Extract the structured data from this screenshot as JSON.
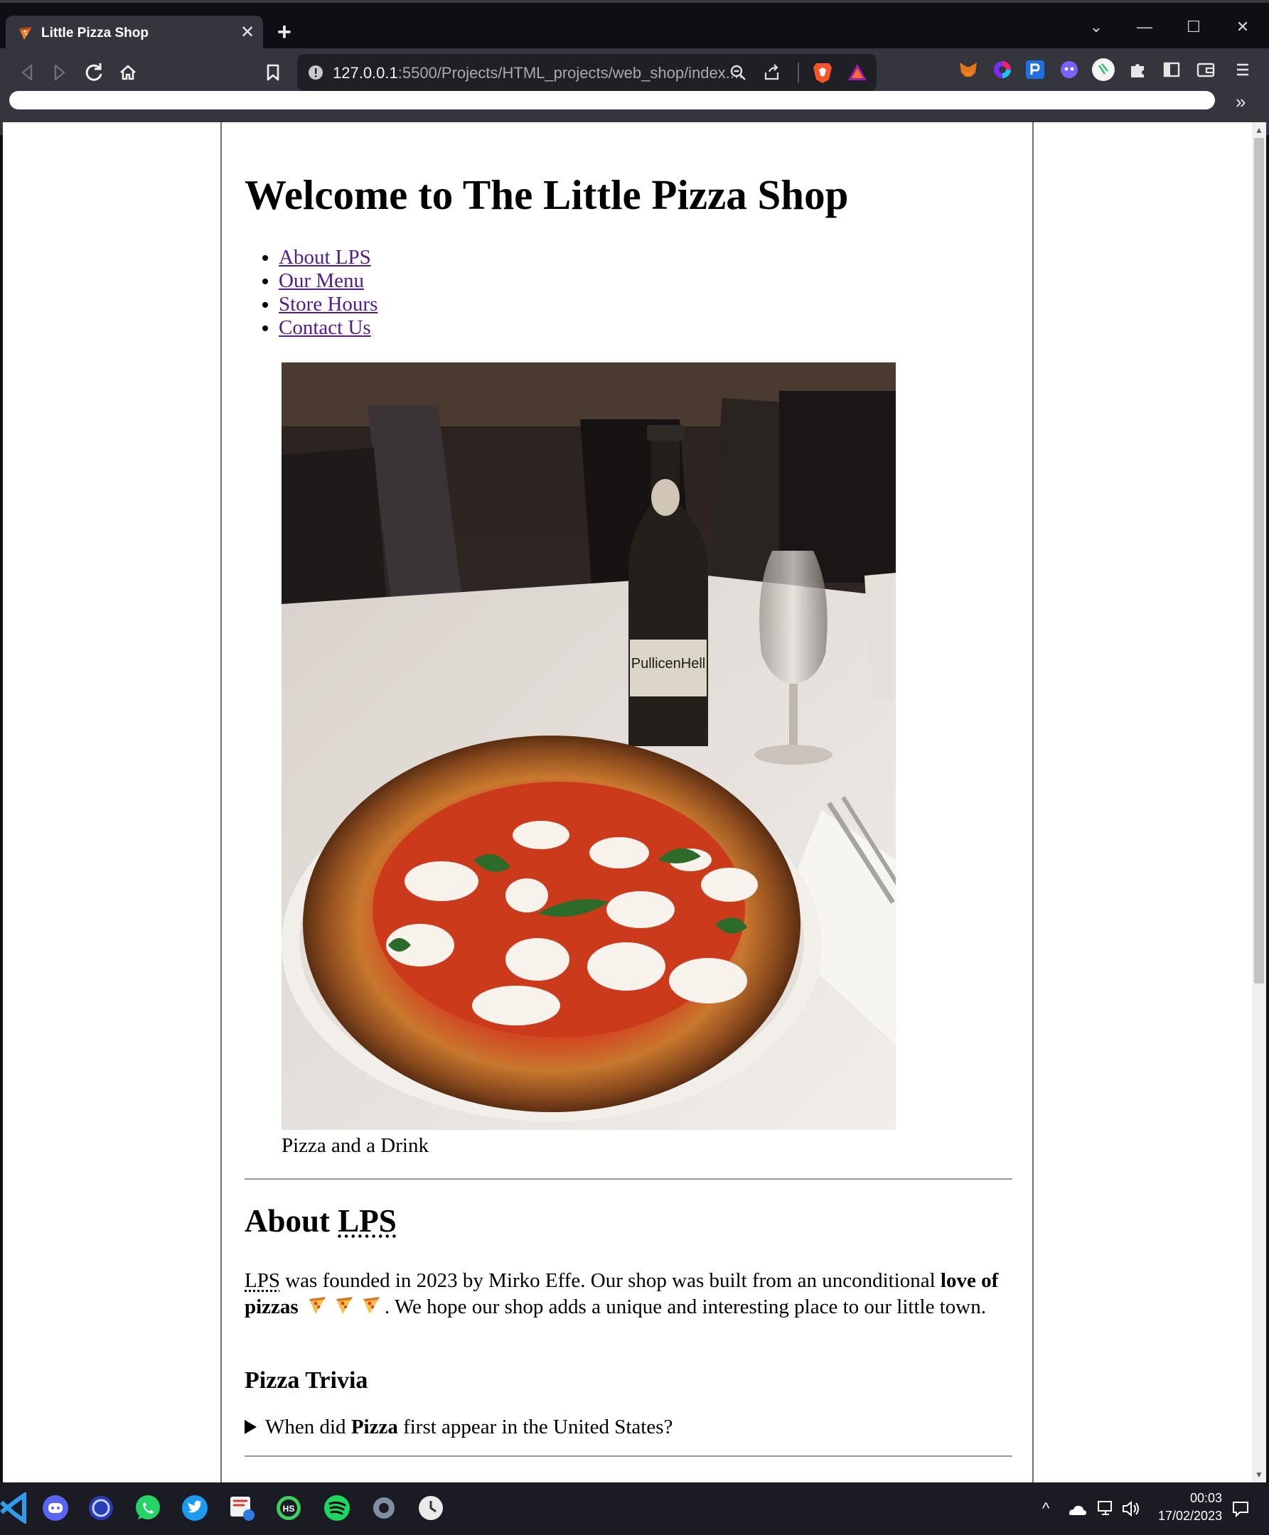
{
  "browser": {
    "tab_title": "Little Pizza Shop",
    "tab_close": "✕",
    "new_tab": "+",
    "url_host": "127.0.0.1",
    "url_path": ":5500/Projects/HTML_projects/web_shop/index....",
    "window_controls": {
      "minimize": "—",
      "maximize": "☐",
      "close": "✕",
      "tab_search": "⌄"
    },
    "bookmarks_overflow": "»",
    "colors": {
      "chrome": "#35363d",
      "titlebar": "#0e0f15",
      "omnibox": "#1f2026"
    }
  },
  "page": {
    "title": "Welcome to The Little Pizza Shop",
    "nav": [
      {
        "label": "About LPS"
      },
      {
        "label": "Our Menu"
      },
      {
        "label": "Store Hours"
      },
      {
        "label": "Contact Us"
      }
    ],
    "hero_caption": "Pizza and a Drink",
    "about": {
      "heading_prefix": "About ",
      "heading_abbr": "LPS",
      "paragraph_abbr": "LPS",
      "paragraph_text_1": " was founded in 2023 by Mirko Effe. Our shop was built from an unconditional ",
      "paragraph_bold": "love of pizzas",
      "paragraph_text_2": ". We hope our shop adds a unique and interesting place to our little town."
    },
    "trivia": {
      "heading": "Pizza Trivia",
      "question_prefix": "When did ",
      "question_bold": "Pizza",
      "question_suffix": " first appear in the United States?"
    },
    "link_color": "#551a8b"
  },
  "taskbar": {
    "apps": [
      "vscode-icon",
      "discord-icon",
      "proton-icon",
      "whatsapp-icon",
      "twitter-icon",
      "snipping-tool-icon",
      "hs-icon",
      "spotify-icon",
      "settings-icon",
      "clock-icon"
    ],
    "tray_arrow": "^",
    "clock_time": "00:03",
    "clock_date": "17/02/2023"
  }
}
